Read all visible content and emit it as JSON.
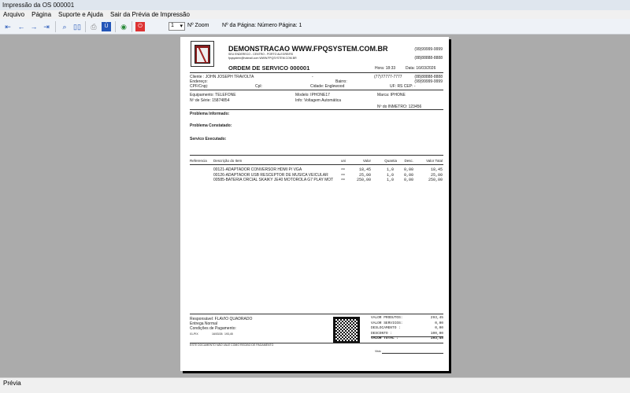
{
  "window": {
    "title": "Impressão da OS 000001"
  },
  "menu": [
    "Arquivo",
    "Página",
    "Suporte e Ajuda",
    "Sair da Prévia de Impressão"
  ],
  "toolbar": {
    "zoom_value": "1",
    "zoom_label": "Nº Zoom",
    "page_label": "Nº da Página: Número Página: 1"
  },
  "status": "Prévia",
  "report": {
    "company": "DEMONSTRACAO WWW.FPQSYSTEM.COM.BR",
    "address": "SEU ENDERECO - CENTRO - PORTO ALEGRE/RS",
    "email": "fpqsystem@hotmail.com  WWW.FPQSYSTEM.COM.BR",
    "phone1": "(99)99999-9999",
    "phone2": "(88)88888-8888",
    "title": "ORDEM DE SERVICO 000001",
    "hora": "Hora: 18:33",
    "data": "Data: 16/03/2026",
    "cliente": "Cliente   : JOHN JOSEPH TRAVOLTA",
    "dash": "-",
    "cli_phone1": "(77)77777-7777",
    "cli_phone2": "(88)88888-8888",
    "cli_phone3": "(99)99999-9999",
    "endereco": "Endereço:",
    "bairro": "Bairro:",
    "cpf": "CPF/Cnpj:",
    "cpl": "Cpl:",
    "cidade": "Cidade: Englewood",
    "uf": "UF: RS  CEP:    -",
    "equipamento": "Equipamento: TELEFONE",
    "modelo": "Modelo: IPHONE17",
    "marca": "Marca: IPHONE",
    "serie": "Nº de Série: 15874854",
    "info": "Info: Voltagem Automática",
    "inmetro": "Nº do INMETRO: 123456",
    "problema_informado": "Problema Informado:",
    "problema_constatado": "Problema Constatado:",
    "servico_executado": "Servico Executado:",
    "columns": [
      "Referencia",
      "Descrição do Item",
      "uni",
      "Valor",
      "Quantia",
      "Desc.",
      "Valor Total"
    ],
    "items": [
      {
        "desc": "00121-ADAPTADOR CONVERSOR HDMI P/ VGA",
        "uni": "UNI",
        "valor": "18,45",
        "qtd": "1,0",
        "desc_v": "0,00",
        "total": "18,45"
      },
      {
        "desc": "00126-ADAPTADOR USB RESCEPTOR DE MUSICA VEICULAR",
        "uni": "UNI",
        "valor": "25,00",
        "qtd": "1,0",
        "desc_v": "0,00",
        "total": "25,00"
      },
      {
        "desc": "00585-BATERIA ORCIAL SKAIKY JE40 MOTOROLA G7 PLAY MOT",
        "uni": "UNI",
        "valor": "250,00",
        "qtd": "1,0",
        "desc_v": "0,00",
        "total": "250,00"
      }
    ],
    "responsavel": "Responsável: FLAVIO QUADRADO",
    "entrega": "Entrega Normal",
    "condicoes": "Condições de Pagamento:",
    "pag": [
      "01-PIX",
      "16/03/26",
      "193,45"
    ],
    "totals": [
      {
        "label": "VALOR PRODUTOS:",
        "value": "293,45"
      },
      {
        "label": "VALOR SERVICOS:",
        "value": "0,00"
      },
      {
        "label": "DESLOCAMENTO   :",
        "value": "0,00"
      },
      {
        "label": "DESCONTO       :",
        "value": "100,00"
      },
      {
        "label": "VALOR TOTAL    :",
        "value": "193,45"
      }
    ],
    "footer": "ESTE DOCUMENTO NÃO VALE COMO RECIBO DE PAGAMENTO",
    "visto": "Visto"
  }
}
